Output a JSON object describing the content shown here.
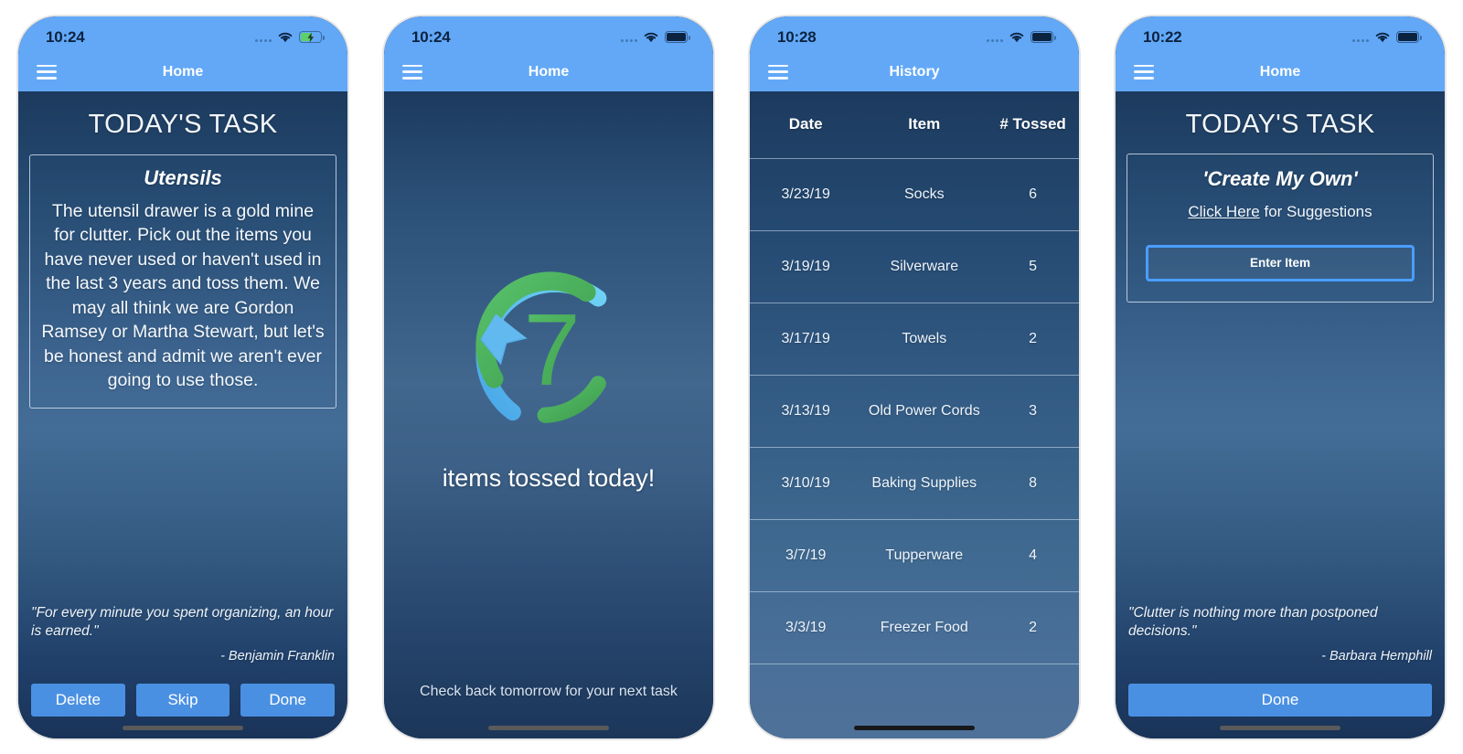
{
  "phones": [
    {
      "status": {
        "time": "10:24",
        "wifi_icon": "wifi-icon",
        "battery_icon": "battery-charging-icon",
        "signal_icon": "signal-dots-icon"
      },
      "nav": {
        "menu_icon": "hamburger-menu-icon",
        "title": "Home"
      },
      "page_title": "TODAY'S TASK",
      "task": {
        "name": "Utensils",
        "description": "The utensil drawer is a gold mine for clutter.  Pick out the items you have never used or haven't used in the last 3 years and toss them. We may all think we are Gordon Ramsey or Martha Stewart, but let's be honest and admit we aren't ever going to use those."
      },
      "quote": {
        "text": "\"For every minute you spent organizing, an hour is earned.\"",
        "author": "- Benjamin Franklin"
      },
      "buttons": [
        "Delete",
        "Skip",
        "Done"
      ]
    },
    {
      "status": {
        "time": "10:24",
        "wifi_icon": "wifi-icon",
        "battery_icon": "battery-full-icon",
        "signal_icon": "signal-dots-icon"
      },
      "nav": {
        "menu_icon": "hamburger-menu-icon",
        "title": "Home"
      },
      "logo": {
        "icon": "recycle-arrows-logo",
        "count": "7",
        "green": "#4caf50",
        "blue": "#56b6f0"
      },
      "tossed_label": "items tossed today!",
      "footer_note": "Check back tomorrow for your next task"
    },
    {
      "status": {
        "time": "10:28",
        "wifi_icon": "wifi-icon",
        "battery_icon": "battery-full-icon",
        "signal_icon": "signal-dots-icon"
      },
      "nav": {
        "menu_icon": "hamburger-menu-icon",
        "title": "History"
      },
      "table": {
        "columns": [
          "Date",
          "Item",
          "# Tossed"
        ],
        "rows": [
          [
            "3/23/19",
            "Socks",
            "6"
          ],
          [
            "3/19/19",
            "Silverware",
            "5"
          ],
          [
            "3/17/19",
            "Towels",
            "2"
          ],
          [
            "3/13/19",
            "Old Power Cords",
            "3"
          ],
          [
            "3/10/19",
            "Baking Supplies",
            "8"
          ],
          [
            "3/7/19",
            "Tupperware",
            "4"
          ],
          [
            "3/3/19",
            "Freezer Food",
            "2"
          ]
        ]
      }
    },
    {
      "status": {
        "time": "10:22",
        "wifi_icon": "wifi-icon",
        "battery_icon": "battery-full-icon",
        "signal_icon": "signal-dots-icon"
      },
      "nav": {
        "menu_icon": "hamburger-menu-icon",
        "title": "Home"
      },
      "page_title": "TODAY'S TASK",
      "create": {
        "title": "'Create My Own'",
        "link_text": "Click Here",
        "suggest_rest": " for Suggestions",
        "input_label": "Enter Item"
      },
      "quote": {
        "text": "\"Clutter is nothing more than postponed decisions.\"",
        "author": "- Barbara Hemphill"
      },
      "buttons": [
        "Done"
      ]
    }
  ],
  "colors": {
    "accent_blue": "#62a8f7",
    "button_blue": "#4a90e2",
    "input_border_blue": "#4a9eff",
    "bg_dark": "#1c3a5e",
    "bg_light": "#4a7099",
    "logo_green": "#4caf50",
    "logo_blue": "#56b6f0"
  }
}
